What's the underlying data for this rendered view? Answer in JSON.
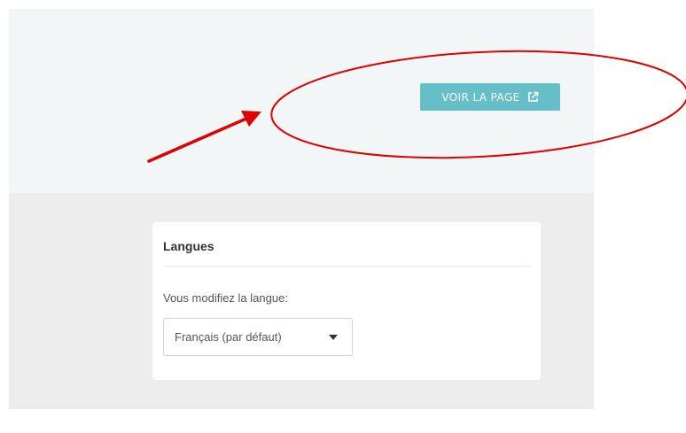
{
  "header": {
    "view_page_label": "VOIR LA PAGE",
    "view_page_icon": "external-link-icon",
    "button_color": "#66bfc8"
  },
  "languages_card": {
    "title": "Langues",
    "editing_label": "Vous modifiez la langue:",
    "selected_language": "Français (par défaut)",
    "dropdown_icon": "caret-down-icon"
  },
  "annotation": {
    "color": "#e00000",
    "shapes": [
      "arrow",
      "ellipse"
    ]
  }
}
